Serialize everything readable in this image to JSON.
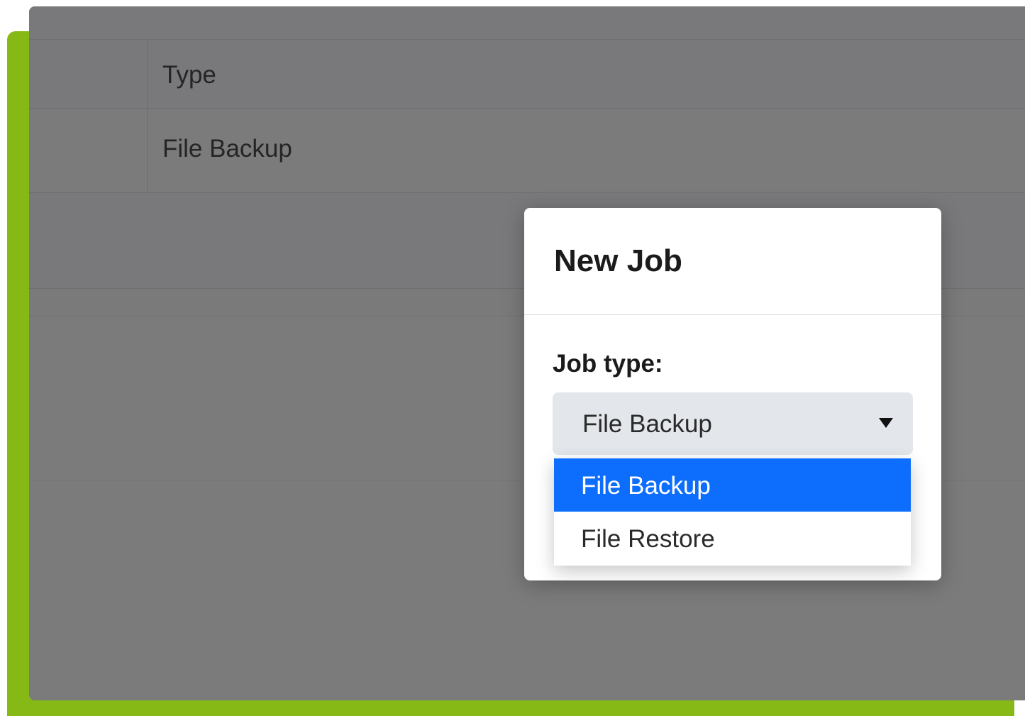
{
  "table": {
    "header": {
      "type_col": "Type"
    },
    "rows": [
      {
        "type": "File Backup"
      }
    ]
  },
  "modal": {
    "title": "New Job",
    "job_type_label": "Job type:",
    "select": {
      "value": "File Backup",
      "options": [
        {
          "label": "File Backup",
          "selected": true
        },
        {
          "label": "File Restore",
          "selected": false
        }
      ]
    }
  },
  "colors": {
    "accent_frame": "#86b916",
    "overlay": "#7b7b7b",
    "selected_option": "#0d6efd",
    "select_bg": "#e3e6ea"
  },
  "icons": {
    "select_caret": "caret-down-icon"
  }
}
